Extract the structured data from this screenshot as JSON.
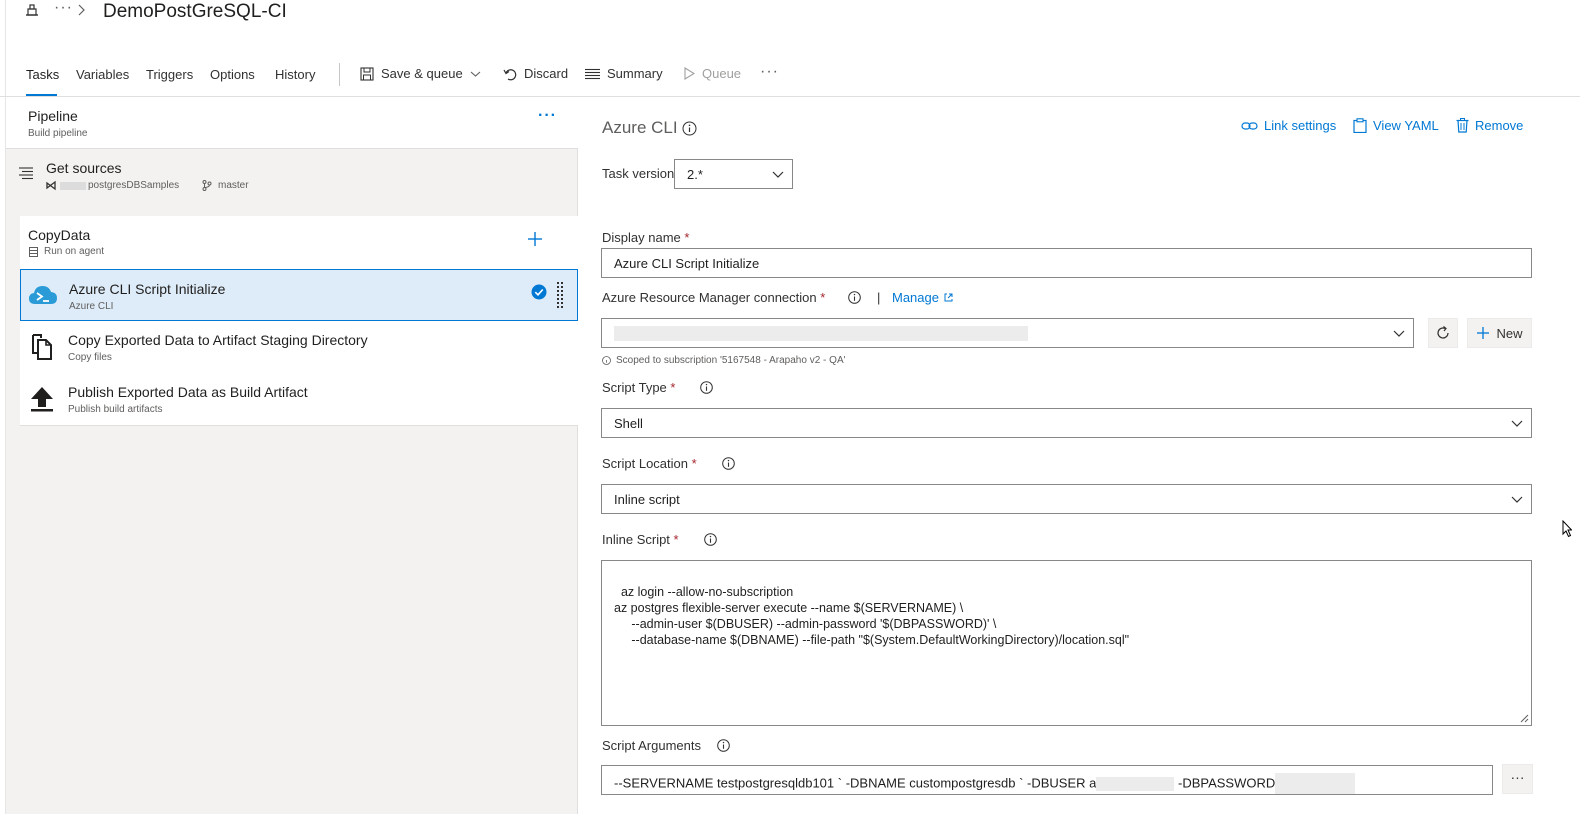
{
  "header": {
    "more": "···",
    "title": "DemoPostGreSQL-CI"
  },
  "toolbar": {
    "tabs": [
      "Tasks",
      "Variables",
      "Triggers",
      "Options",
      "History"
    ],
    "save_queue": "Save & queue",
    "discard": "Discard",
    "summary": "Summary",
    "queue": "Queue",
    "more": "···"
  },
  "pipeline": {
    "title": "Pipeline",
    "subtitle": "Build pipeline",
    "more": "···"
  },
  "get_sources": {
    "title": "Get sources",
    "repo": "postgresDBSamples",
    "branch": "master"
  },
  "job": {
    "title": "CopyData",
    "subtitle": "Run on agent"
  },
  "tasks": [
    {
      "name": "Azure CLI Script Initialize",
      "subtitle": "Azure CLI"
    },
    {
      "name": "Copy Exported Data to Artifact Staging Directory",
      "subtitle": "Copy files"
    },
    {
      "name": "Publish Exported Data as Build Artifact",
      "subtitle": "Publish build artifacts"
    }
  ],
  "detail": {
    "title": "Azure CLI",
    "link_settings": "Link settings",
    "view_yaml": "View YAML",
    "remove": "Remove",
    "task_version_label": "Task version",
    "task_version": "2.*",
    "display_name_label": "Display name",
    "display_name": "Azure CLI Script Initialize",
    "arm_label": "Azure Resource Manager connection",
    "separator": "|",
    "manage": "Manage",
    "new": "New",
    "scoped": "Scoped to subscription '5167548 - Arapaho v2 - QA'",
    "script_type_label": "Script Type",
    "script_type": "Shell",
    "script_location_label": "Script Location",
    "script_location": "Inline script",
    "inline_script_label": "Inline Script",
    "inline_script": "az login --allow-no-subscription\naz postgres flexible-server execute --name $(SERVERNAME) \\\n     --admin-user $(DBUSER) --admin-password '$(DBPASSWORD)' \\\n     --database-name $(DBNAME) --file-path \"$(System.DefaultWorkingDirectory)/location.sql\"",
    "script_args_label": "Script Arguments",
    "script_args_part1": "--SERVERNAME testpostgresqldb101 ` -DBNAME custompostgresdb ` -DBUSER a",
    "script_args_part2": "-DBPASSWORD",
    "args_more": "···"
  },
  "colors": {
    "accent": "#0078d4",
    "selected_bg": "#deecf9",
    "required": "#a4262c",
    "panel_bg": "#f3f2f1"
  }
}
